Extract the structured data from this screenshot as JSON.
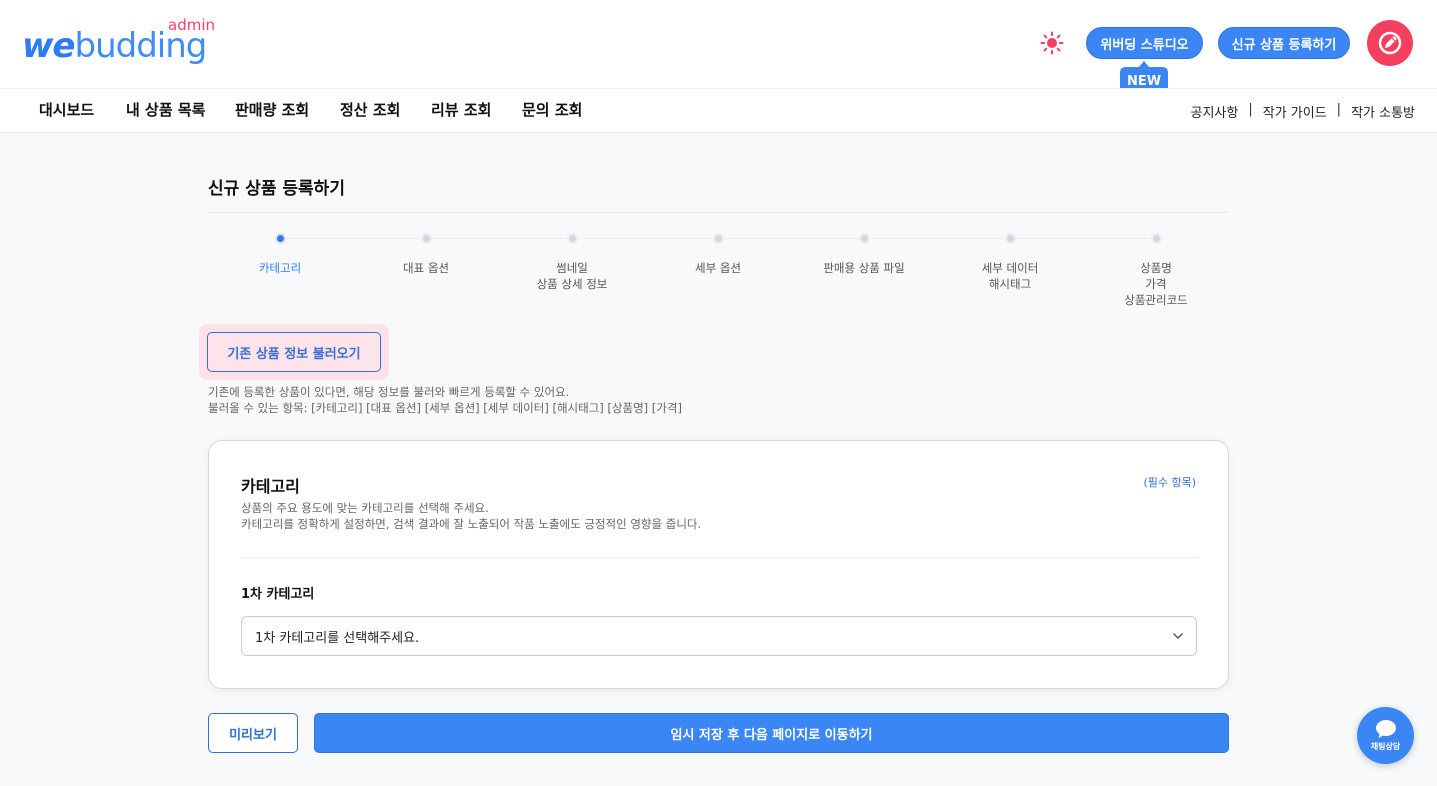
{
  "header": {
    "logo_we": "we",
    "logo_budding": "budding",
    "logo_admin": "admin",
    "studio_label": "위버딩 스튜디오",
    "new_badge": "NEW",
    "new_product_label": "신규 상품 등록하기",
    "icons": {
      "theme": "sun-icon",
      "avatar": "pencil-icon"
    },
    "brand_color": "#3b86f5",
    "avatar_color": "#f43f5e"
  },
  "nav": {
    "items": [
      "대시보드",
      "내 상품 목록",
      "판매량 조회",
      "정산 조회",
      "리뷰 조회",
      "문의 조회"
    ],
    "links": [
      "공지사항",
      "작가 가이드",
      "작가 소통방"
    ],
    "separator": "|"
  },
  "page": {
    "title": "신규 상품 등록하기",
    "steps": [
      {
        "label": "카테고리",
        "active": true
      },
      {
        "label": "대표 옵션",
        "active": false
      },
      {
        "label": "썸네일\n상품 상세 정보",
        "active": false
      },
      {
        "label": "세부 옵션",
        "active": false
      },
      {
        "label": "판매용 상품 파일",
        "active": false
      },
      {
        "label": "세부 데이터\n해시태그",
        "active": false
      },
      {
        "label": "상품명\n가격\n상품관리코드",
        "active": false
      }
    ],
    "load_button": "기존 상품 정보 불러오기",
    "help_line1": "기존에 등록한 상품이 있다면, 해당 정보를 불러와 빠르게 등록할 수 있어요.",
    "help_line2": "불러올 수 있는 항목: [카테고리] [대표 옵션] [세부 옵션] [세부 데이터] [해시태그] [상품명] [가격]"
  },
  "card": {
    "title": "카테고리",
    "required": "(필수 항목)",
    "desc_line1": "상품의 주요 용도에 맞는 카테고리를 선택해 주세요.",
    "desc_line2": "카테고리를 정확하게 설정하면, 검색 결과에 잘 노출되어 작품 노출에도 긍정적인 영향을 줍니다.",
    "field_label": "1차 카테고리",
    "select_value": "1차 카테고리를 선택해주세요."
  },
  "footer": {
    "preview_label": "미리보기",
    "next_label": "임시 저장 후 다음 페이지로 이동하기",
    "chat_label": "채팅상담"
  }
}
